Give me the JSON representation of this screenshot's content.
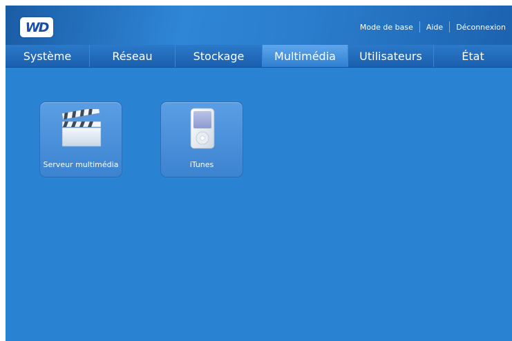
{
  "header": {
    "logo_text": "WD",
    "links": {
      "basic_mode": "Mode de base",
      "help": "Aide",
      "logout": "Déconnexion"
    }
  },
  "nav": {
    "tabs": [
      {
        "label": "Système"
      },
      {
        "label": "Réseau"
      },
      {
        "label": "Stockage"
      },
      {
        "label": "Multimédia",
        "active": true
      },
      {
        "label": "Utilisateurs"
      },
      {
        "label": "État"
      }
    ]
  },
  "tiles": [
    {
      "label": "Serveur multimédia",
      "icon": "clapperboard-icon"
    },
    {
      "label": "iTunes",
      "icon": "ipod-icon"
    }
  ],
  "colors": {
    "background": "#2a82d3",
    "tab_active": "#4a96e0"
  }
}
